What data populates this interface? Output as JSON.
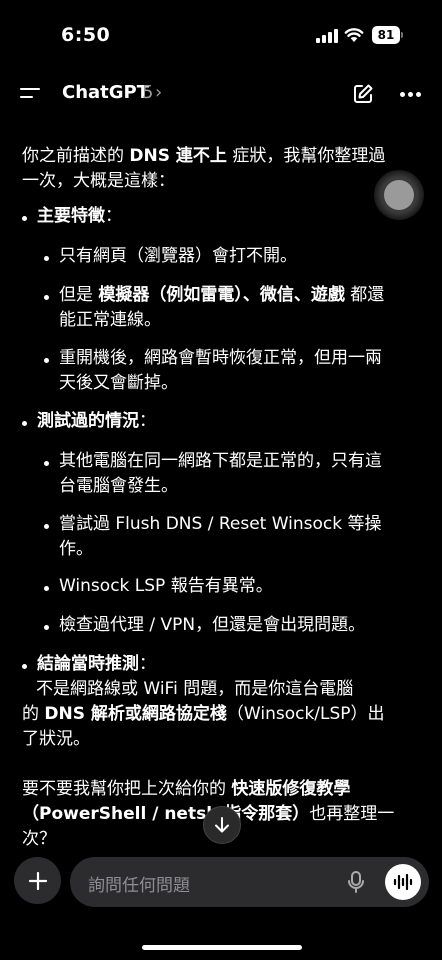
{
  "status_bar": {
    "time": "6:50",
    "battery": "81"
  },
  "header": {
    "title": "ChatGPT",
    "version": "5",
    "chevron": "›"
  },
  "message": {
    "intro_1": "你之前描述的 ",
    "intro_bold": "DNS 連不上",
    "intro_2": " 症狀，我幫你整理過",
    "intro_3": "一次，大概是這樣：",
    "section1": {
      "title": "主要特徵",
      "colon": "："
    },
    "s1_item1": "只有網頁（瀏覽器）會打不開。",
    "s1_item2_a": "但是 ",
    "s1_item2_bold": "模擬器（例如雷電）、微信、遊戲",
    "s1_item2_b": " 都還",
    "s1_item2_c": "能正常連線。",
    "s1_item3_a": "重開機後，網路會暫時恢復正常，但用一兩",
    "s1_item3_b": "天後又會斷掉。",
    "section2": {
      "title": "測試過的情況",
      "colon": "："
    },
    "s2_item1_a": "其他電腦在同一網路下都是正常的，只有這",
    "s2_item1_b": "台電腦會發生。",
    "s2_item2_a": "嘗試過 Flush DNS / Reset Winsock 等操",
    "s2_item2_b": "作。",
    "s2_item3": "Winsock LSP 報告有異常。",
    "s2_item4": "檢查過代理 / VPN，但還是會出現問題。",
    "section3": {
      "title": "結論當時推測",
      "colon": "："
    },
    "s3_line1": "不是網路線或 WiFi 問題，而是你這台電腦",
    "s3_line2_a": "的 ",
    "s3_line2_bold": "DNS 解析或網路協定棧",
    "s3_line2_b": "（Winsock/LSP）出",
    "s3_line3": "了狀況。",
    "outro_1_a": "要不要我幫你把上次給你的 ",
    "outro_1_bold": "快速版修復教學",
    "outro_2_bold": "（PowerShell / netsh 指令那套）",
    "outro_2_b": "也再整理一次？"
  },
  "composer": {
    "placeholder": "詢問任何問題"
  },
  "icons": {
    "menu": "menu-icon",
    "compose": "compose-icon",
    "more": "more-icon",
    "plus": "plus-icon",
    "mic": "mic-icon",
    "voice": "voice-waveform-icon",
    "scroll": "arrow-down-icon"
  }
}
